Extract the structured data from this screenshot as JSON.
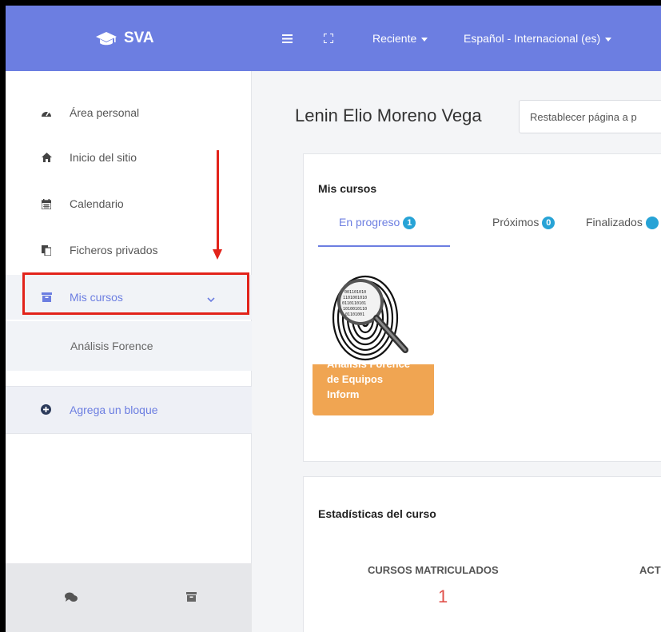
{
  "navbar": {
    "brand": "SVA",
    "recent_label": "Reciente",
    "language_label": "Español - Internacional (es)"
  },
  "sidebar": {
    "items": [
      {
        "label": "Área personal",
        "icon": "dashboard-icon"
      },
      {
        "label": "Inicio del sitio",
        "icon": "home-icon"
      },
      {
        "label": "Calendario",
        "icon": "calendar-icon"
      },
      {
        "label": "Ficheros privados",
        "icon": "files-icon"
      },
      {
        "label": "Mis cursos",
        "icon": "archive-icon"
      }
    ],
    "sub_item": "Análisis Forence",
    "add_block": "Agrega un bloque",
    "footer_icons": [
      "messages-icon",
      "archive-icon"
    ]
  },
  "main": {
    "user_name": "Lenin Elio Moreno Vega",
    "reset_button": "Restablecer página a p"
  },
  "mis_cursos": {
    "title": "Mis cursos",
    "tabs": [
      {
        "label": "En progreso",
        "count": "1"
      },
      {
        "label": "Próximos",
        "count": "0"
      },
      {
        "label": "Finalizados",
        "count": ""
      }
    ],
    "course": {
      "name": "Análisis Forence de Equipos Inform"
    }
  },
  "stats": {
    "title": "Estadísticas del curso",
    "enrolled_label": "CURSOS MATRICULADOS",
    "enrolled_value": "1",
    "active_label": "ACT"
  },
  "colors": {
    "accent": "#6c7ee1",
    "badge": "#27a3d6",
    "course_card": "#f0a552",
    "annotation": "#e2231a",
    "stat_value": "#e0504a"
  }
}
